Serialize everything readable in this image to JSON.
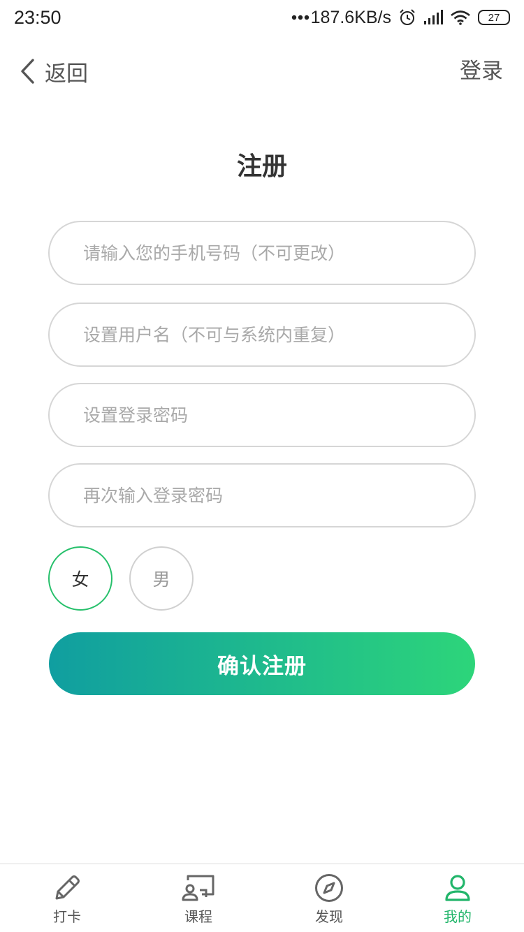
{
  "status_bar": {
    "time": "23:50",
    "network_speed": "187.6KB/s",
    "battery": "27",
    "icons": [
      "dots-icon",
      "alarm-icon",
      "signal-icon",
      "wifi-icon",
      "battery-icon"
    ]
  },
  "header": {
    "back_label": "返回",
    "login_label": "登录"
  },
  "page": {
    "title": "注册"
  },
  "form": {
    "phone_placeholder": "请输入您的手机号码（不可更改）",
    "username_placeholder": "设置用户名（不可与系统内重复）",
    "password_placeholder": "设置登录密码",
    "confirm_password_placeholder": "再次输入登录密码",
    "gender_female": "女",
    "gender_male": "男",
    "selected_gender": "女",
    "submit_label": "确认注册"
  },
  "tab_bar": {
    "items": [
      {
        "label": "打卡",
        "icon": "pencil-icon",
        "active": false
      },
      {
        "label": "课程",
        "icon": "course-icon",
        "active": false
      },
      {
        "label": "发现",
        "icon": "compass-icon",
        "active": false
      },
      {
        "label": "我的",
        "icon": "user-icon",
        "active": true
      }
    ]
  },
  "colors": {
    "accent": "#26c06b",
    "gradient_start": "#109ea0",
    "gradient_end": "#2dd57a",
    "active_tab": "#21b56a"
  }
}
